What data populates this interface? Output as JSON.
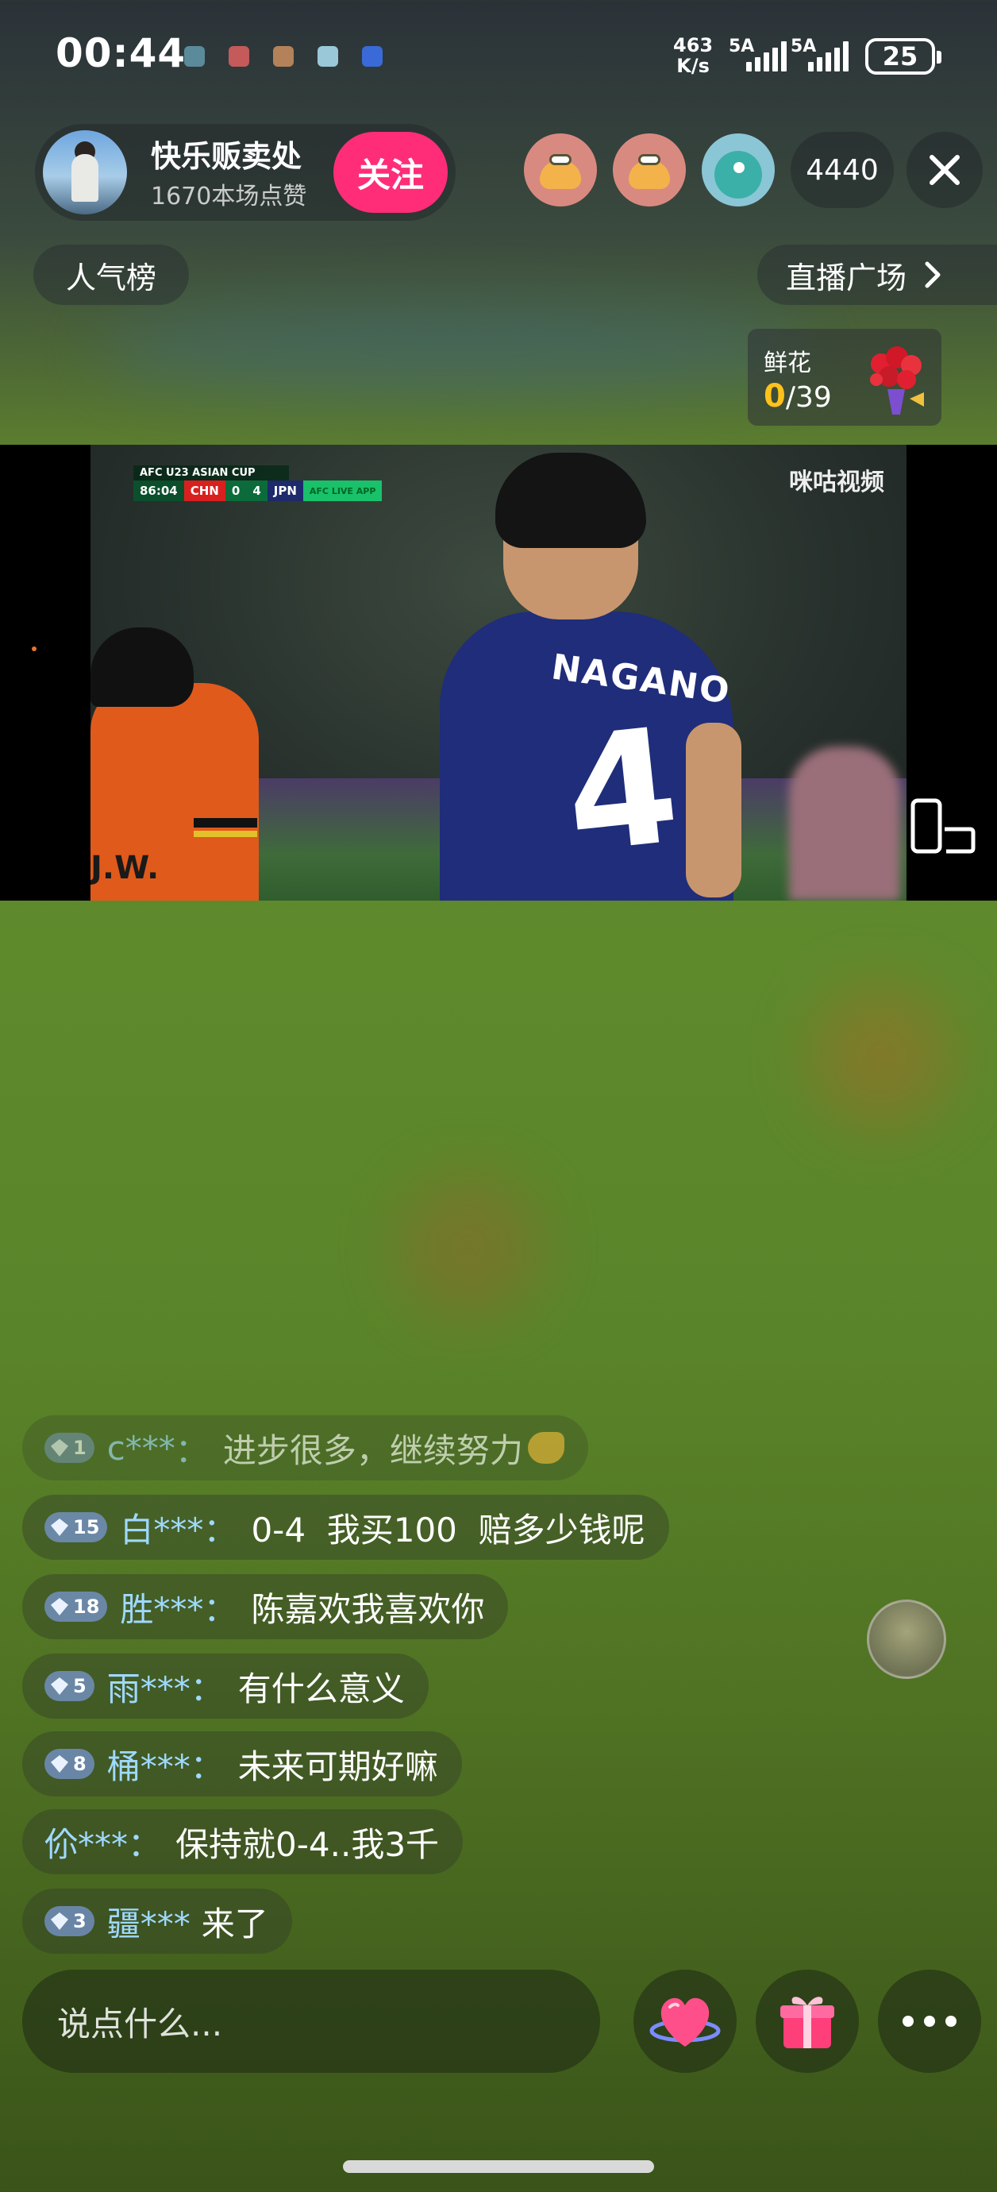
{
  "status_bar": {
    "time": "00:44",
    "net_speed_value": "463",
    "net_speed_unit": "K/s",
    "signal1_label": "5A",
    "signal2_label": "5A",
    "battery": "25"
  },
  "host": {
    "name": "快乐贩卖处",
    "likes": "1670本场点赞",
    "follow_label": "关注"
  },
  "viewers": {
    "count": "4440"
  },
  "nav": {
    "rank_label": "人气榜",
    "plaza_label": "直播广场"
  },
  "gift_goal": {
    "label": "鲜花",
    "current": "0",
    "total": "39"
  },
  "video": {
    "tournament": "AFC U23 ASIAN CUP",
    "clock": "86:04",
    "team_home": "CHN",
    "score_home": "0",
    "score_away": "4",
    "team_away": "JPN",
    "app_tag": "AFC LIVE APP",
    "broadcaster": "咪咕视频",
    "player_name": "NAGANO",
    "player_number": "4",
    "player2_name": "J.W."
  },
  "comments": [
    {
      "level": "1",
      "user": "c***",
      "text": "进步很多，继续努力",
      "emoji": "muscle"
    },
    {
      "level": "15",
      "user": "白***",
      "text": "0-4  我买100  赔多少钱呢"
    },
    {
      "level": "18",
      "user": "胜***",
      "text": "陈嘉欢我喜欢你"
    },
    {
      "level": "5",
      "user": "雨***",
      "text": "有什么意义"
    },
    {
      "level": "8",
      "user": "桶***",
      "text": "未来可期好嘛"
    },
    {
      "level": "",
      "user": "伱***",
      "text": "保持就0-4..我3千"
    },
    {
      "level": "3",
      "user": "疆***",
      "text": "来了"
    }
  ],
  "input": {
    "placeholder": "说点什么..."
  },
  "colors": {
    "follow": "#ff2d78",
    "username": "#9fd9ff",
    "goal_current": "#ffc21a"
  }
}
